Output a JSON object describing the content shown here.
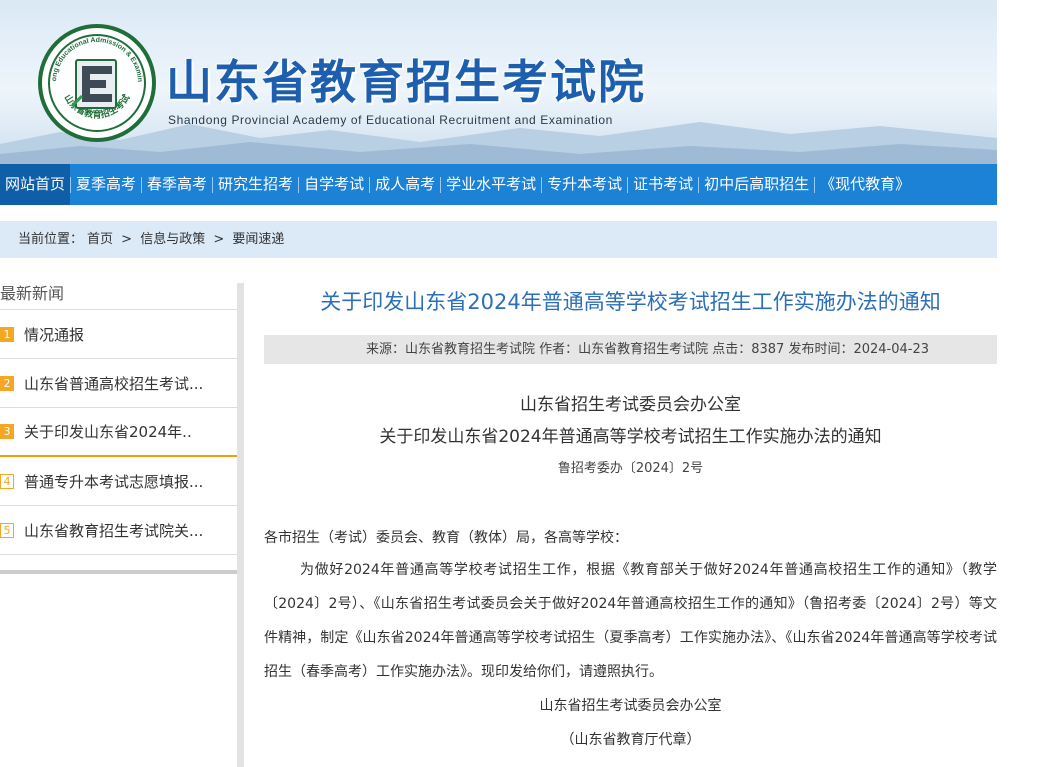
{
  "header": {
    "site_title": "山东省教育招生考试院",
    "site_subtitle": "Shandong Provincial Academy of Educational Recruitment and Examination",
    "logo": {
      "ring_text_top": "Shandong Educational Admission & Examinations",
      "ring_text_bottom": "山东省教育招生考试",
      "mark": "E"
    }
  },
  "nav": {
    "items": [
      {
        "label": "网站首页",
        "active": true
      },
      {
        "label": "夏季高考"
      },
      {
        "label": "春季高考"
      },
      {
        "label": "研究生招考"
      },
      {
        "label": "自学考试"
      },
      {
        "label": "成人高考"
      },
      {
        "label": "学业水平考试"
      },
      {
        "label": "专升本考试"
      },
      {
        "label": "证书考试"
      },
      {
        "label": "初中后高职招生"
      },
      {
        "label": "《现代教育》"
      }
    ]
  },
  "breadcrumb": {
    "prefix": "当前位置：",
    "items": [
      "首页",
      "信息与政策",
      "要闻速递"
    ],
    "separator": ">"
  },
  "sidebar": {
    "heading": "最新新闻",
    "items": [
      {
        "num": "1",
        "label": "情况通报"
      },
      {
        "num": "2",
        "label": "山东省普通高校招生考试..."
      },
      {
        "num": "3",
        "label": "关于印发山东省2024年.."
      },
      {
        "num": "4",
        "label": "普通专升本考试志愿填报..."
      },
      {
        "num": "5",
        "label": "山东省教育招生考试院关..."
      }
    ]
  },
  "article": {
    "title": "关于印发山东省2024年普通高等学校考试招生工作实施办法的通知",
    "meta": "来源：山东省教育招生考试院 作者：山东省教育招生考试院 点击：8387 发布时间：2024-04-23",
    "doc_org": "山东省招生考试委员会办公室",
    "doc_title": "关于印发山东省2024年普通高等学校考试招生工作实施办法的通知",
    "doc_no": "鲁招考委办〔2024〕2号",
    "salutation": "各市招生（考试）委员会、教育（教体）局，各高等学校：",
    "body": "为做好2024年普通高等学校考试招生工作，根据《教育部关于做好2024年普通高校招生工作的通知》（教学〔2024〕2号）、《山东省招生考试委员会关于做好2024年普通高校招生工作的通知》（鲁招考委〔2024〕2号）等文件精神，制定《山东省2024年普通高等学校考试招生（夏季高考）工作实施办法》、《山东省2024年普通高等学校考试招生（春季高考）工作实施办法》。现印发给你们，请遵照执行。",
    "sign_org": "山东省招生考试委员会办公室",
    "sign_sub": "（山东省教育厅代章）"
  },
  "colors": {
    "nav_bg": "#1c82d6",
    "nav_active": "#0f5fa8",
    "title_blue": "#2c6fb8",
    "accent_orange": "#f5a623",
    "logo_green": "#1f6e3a"
  }
}
